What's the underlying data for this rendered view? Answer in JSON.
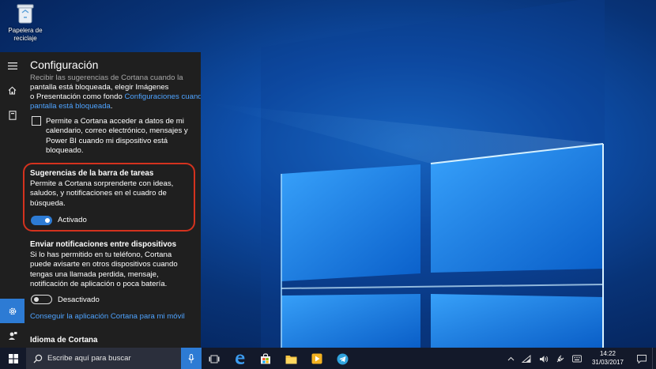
{
  "desktop": {
    "recycle_bin_label": "Papelera de reciclaje"
  },
  "settings": {
    "title": "Configuración",
    "lockscreen_text_1": "Recibir las sugerencias de Cortana cuando la",
    "lockscreen_text_2": "pantalla está bloqueada, elegir Imágenes",
    "lockscreen_text_3": "o  Presentación como fondo",
    "lockscreen_link_a": "Configuraciones cuando la",
    "lockscreen_link_b": "pantalla está bloqueada",
    "lockscreen_link_end": ".",
    "calendar_checkbox": {
      "line1": "Permite a Cortana acceder a datos de mi",
      "line2": "calendario, correo electrónico, mensajes y",
      "line3": "Power BI cuando mi dispositivo está",
      "line4": "bloqueado.",
      "checked": false
    },
    "taskbar_tips": {
      "heading": "Sugerencias de la barra de tareas",
      "line1": "Permite a Cortana sorprenderte con ideas,",
      "line2": "saludos, y notificaciones en el cuadro de",
      "line3": "búsqueda.",
      "toggle_state": "Activado",
      "toggle_on": true
    },
    "cross_device": {
      "heading": "Enviar notificaciones entre dispositivos",
      "line1": "Si lo has permitido en tu teléfono, Cortana",
      "line2": "puede avisarte en otros dispositivos cuando",
      "line3": "tengas una llamada perdida, mensaje,",
      "line4": "notificación de aplicación o poca batería.",
      "toggle_state": "Desactivado",
      "toggle_on": false,
      "link": "Conseguir la aplicación Cortana para mi móvil"
    },
    "language": {
      "heading": "Idioma de Cortana"
    }
  },
  "taskbar": {
    "search_placeholder": "Escribe aquí para buscar",
    "time": "14:22",
    "date": "31/03/2017"
  },
  "colors": {
    "accent": "#2d7bd4",
    "link": "#4ea3ff",
    "highlight": "#d4321e",
    "panel_bg": "#1f1f1f",
    "taskbar_bg": "#13192a"
  }
}
